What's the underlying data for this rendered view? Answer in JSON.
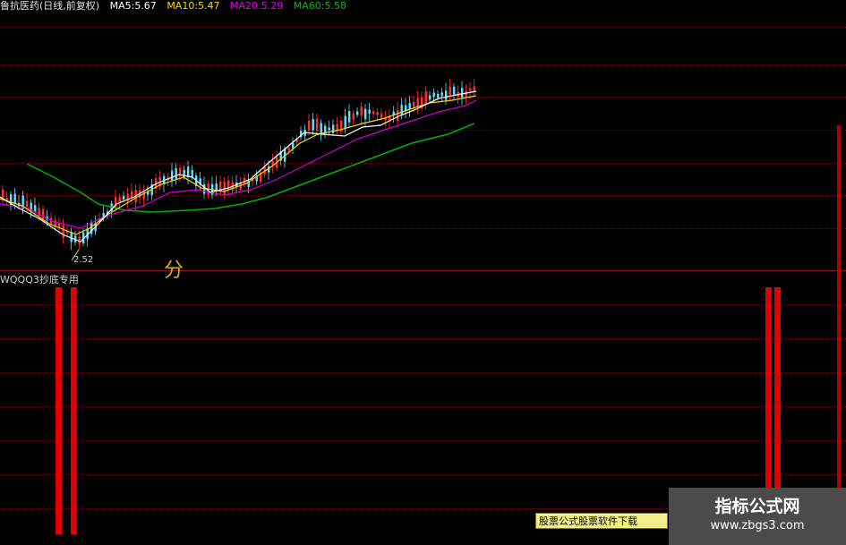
{
  "header": {
    "stock_title": "鲁抗医药(日线,前复权)",
    "ma5": "MA5:5.67",
    "ma10": "MA10:5.47",
    "ma20": "MA20:5.29",
    "ma60": "MA60:5.58"
  },
  "colors": {
    "ma5": "#ffffff",
    "ma10": "#ffd700",
    "ma20": "#e000e0",
    "ma60": "#00c000",
    "up": "#ff3030",
    "down": "#60e0ff"
  },
  "price_label": "2.52",
  "overlay_char": "分",
  "indicator": {
    "title": "WQQQ3抄底专用"
  },
  "watermark": {
    "ad_text": "股票公式股票软件下载",
    "logo_title": "指标公式网",
    "logo_url": "www.zbgs3.com"
  }
}
